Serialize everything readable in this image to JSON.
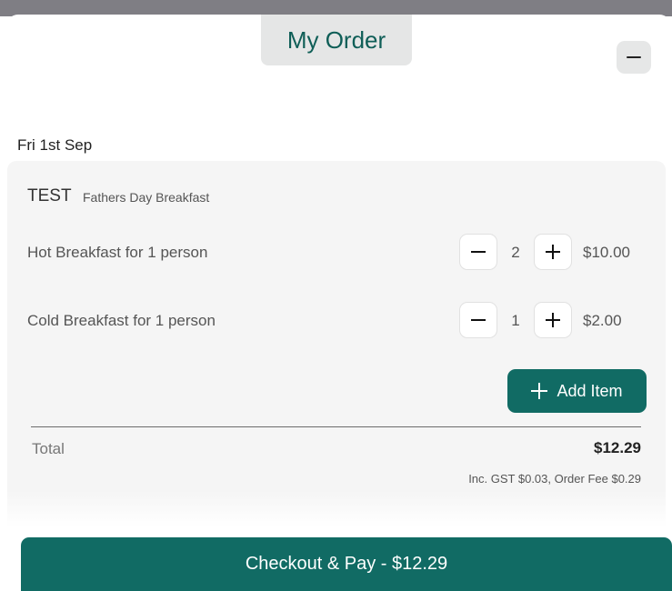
{
  "sheet": {
    "title": "My Order"
  },
  "order": {
    "date": "Fri 1st Sep",
    "event_name": "TEST",
    "event_subtitle": "Fathers Day Breakfast",
    "items": [
      {
        "name": "Hot Breakfast for 1 person",
        "quantity": "2",
        "price": "$10.00"
      },
      {
        "name": "Cold Breakfast for 1 person",
        "quantity": "1",
        "price": "$2.00"
      }
    ],
    "add_item_label": "Add Item",
    "total_label": "Total",
    "total_value": "$12.29",
    "fees": "Inc. GST $0.03, Order Fee $0.29"
  },
  "checkout": {
    "label": "Checkout & Pay - $12.29"
  },
  "icons": {
    "collapse": "minus-icon",
    "decrease": "minus-icon",
    "increase": "plus-icon",
    "add": "plus-icon"
  },
  "colors": {
    "accent": "#116b64",
    "title_text": "#0f5e57",
    "card_bg": "#f5f5f5"
  }
}
